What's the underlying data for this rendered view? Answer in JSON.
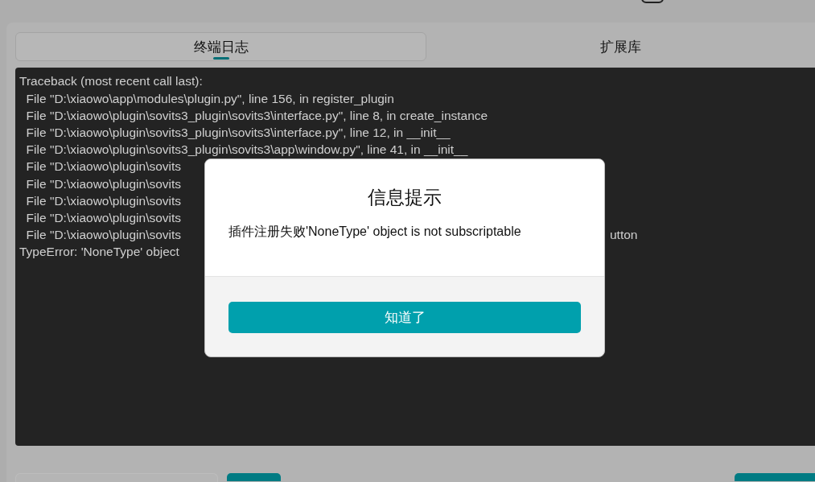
{
  "tabs": [
    {
      "label": "终端日志",
      "selected": true
    },
    {
      "label": "扩展库",
      "selected": false
    }
  ],
  "terminal": {
    "lines": [
      {
        "text": "Traceback (most recent call last):"
      },
      {
        "text": "  File \"D:\\xiaowo\\app\\modules\\plugin.py\", line 156, in register_plugin"
      },
      {
        "text": "  File \"D:\\xiaowo\\plugin\\sovits3_plugin\\sovits3\\interface.py\", line 8, in create_instance"
      },
      {
        "text": "  File \"D:\\xiaowo\\plugin\\sovits3_plugin\\sovits3\\interface.py\", line 12, in __init__"
      },
      {
        "text": "  File \"D:\\xiaowo\\plugin\\sovits3_plugin\\sovits3\\app\\window.py\", line 41, in __init__"
      },
      {
        "text": "  File \"D:\\xiaowo\\plugin\\sovits"
      },
      {
        "text": "  File \"D:\\xiaowo\\plugin\\sovits"
      },
      {
        "text": "  File \"D:\\xiaowo\\plugin\\sovits"
      },
      {
        "text": "  File \"D:\\xiaowo\\plugin\\sovits"
      },
      {
        "text": "  File \"D:\\xiaowo\\plugin\\sovits",
        "tail": "utton"
      },
      {
        "text": "TypeError: 'NoneType' object"
      }
    ]
  },
  "dialog": {
    "title": "信息提示",
    "message": "插件注册失败'NoneType' object is not subscriptable",
    "button": "知道了"
  }
}
